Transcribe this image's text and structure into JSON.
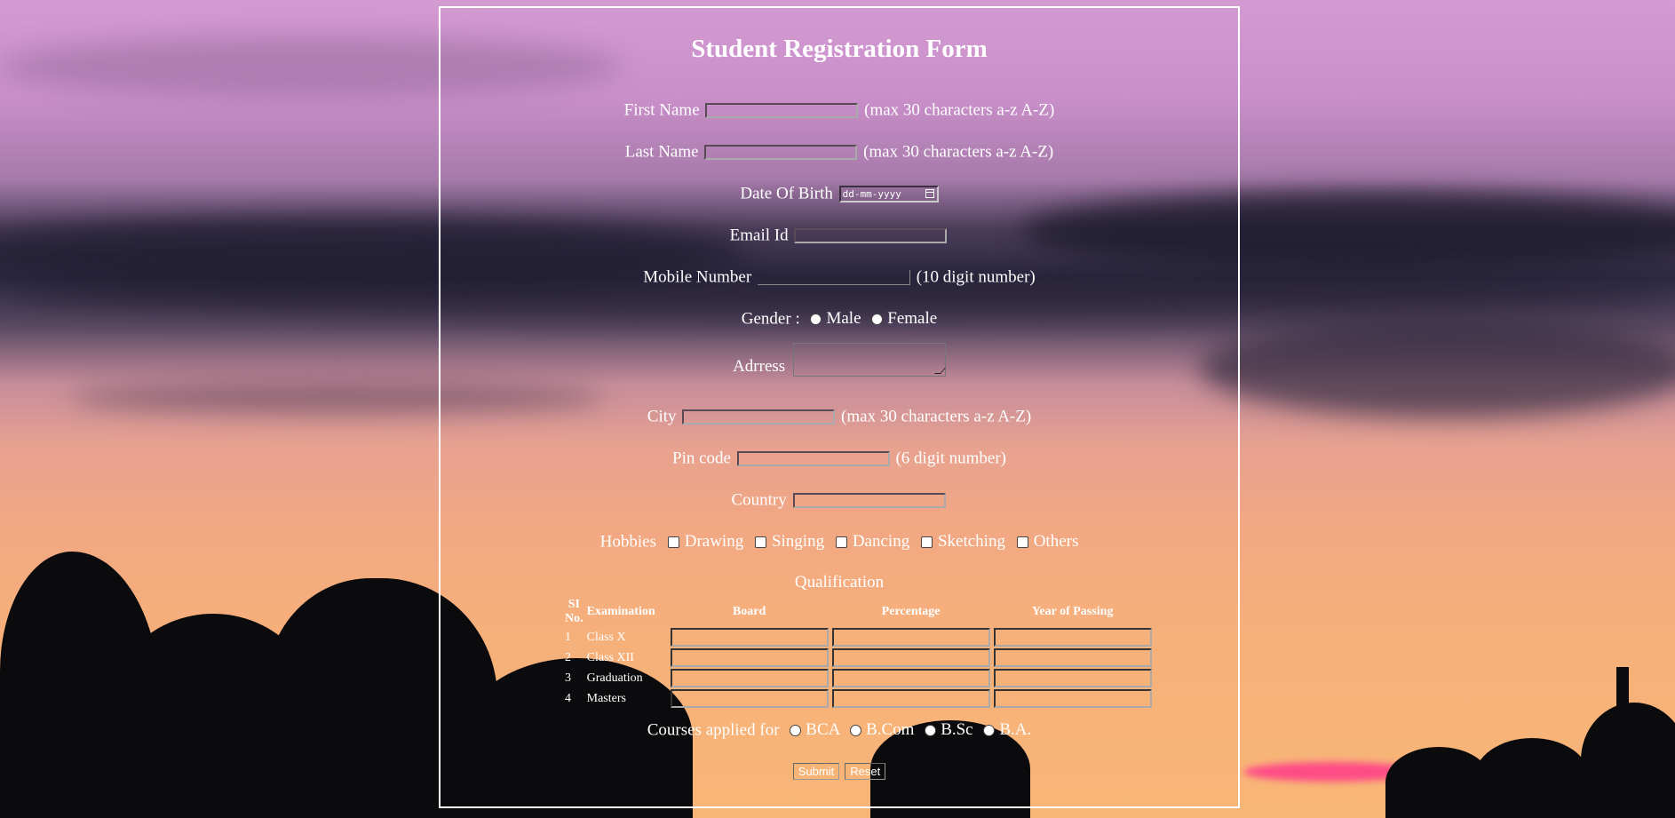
{
  "form": {
    "title": "Student Registration Form",
    "first_name": {
      "label": "First Name",
      "hint": "(max 30 characters a-z A-Z)",
      "value": ""
    },
    "last_name": {
      "label": "Last Name",
      "hint": "(max 30 characters a-z A-Z)",
      "value": ""
    },
    "dob": {
      "label": "Date Of Birth",
      "placeholder": "dd-mm-yyyy"
    },
    "email": {
      "label": "Email Id",
      "value": ""
    },
    "mobile": {
      "label": "Mobile Number",
      "hint": "(10 digit number)",
      "value": ""
    },
    "gender": {
      "label": "Gender :",
      "options": [
        "Male",
        "Female"
      ]
    },
    "address": {
      "label": "Adrress",
      "value": ""
    },
    "city": {
      "label": "City",
      "hint": "(max 30 characters a-z A-Z)",
      "value": ""
    },
    "pincode": {
      "label": "Pin code",
      "hint": "(6 digit number)",
      "value": ""
    },
    "country": {
      "label": "Country",
      "value": ""
    },
    "hobbies": {
      "label": "Hobbies",
      "options": [
        "Drawing",
        "Singing",
        "Dancing",
        "Sketching",
        "Others"
      ]
    },
    "qualification": {
      "title": "Qualification",
      "headers": [
        "SI No.",
        "Examination",
        "Board",
        "Percentage",
        "Year of Passing"
      ],
      "rows": [
        {
          "sn": "1",
          "exam": "Class X"
        },
        {
          "sn": "2",
          "exam": "Class XII"
        },
        {
          "sn": "3",
          "exam": "Graduation"
        },
        {
          "sn": "4",
          "exam": "Masters"
        }
      ]
    },
    "courses": {
      "label": "Courses applied for",
      "options": [
        "BCA",
        "B.Com",
        "B.Sc",
        "B.A."
      ]
    },
    "submit_label": "Submit",
    "reset_label": "Reset"
  }
}
